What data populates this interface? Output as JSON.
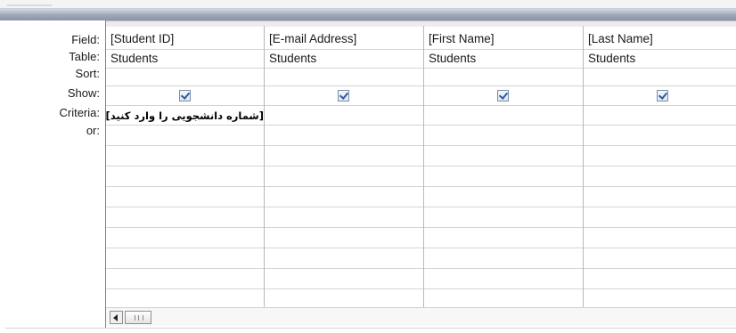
{
  "row_labels": {
    "field": "Field:",
    "table": "Table:",
    "sort": "Sort:",
    "show": "Show:",
    "criteria": "Criteria:",
    "or": "or:"
  },
  "columns": [
    {
      "field": "[Student ID]",
      "table": "Students",
      "sort": "",
      "show": true,
      "criteria": "[شماره دانشجویی را وارد کنید]"
    },
    {
      "field": "[E-mail Address]",
      "table": "Students",
      "sort": "",
      "show": true,
      "criteria": ""
    },
    {
      "field": "[First Name]",
      "table": "Students",
      "sort": "",
      "show": true,
      "criteria": ""
    },
    {
      "field": "[Last Name]",
      "table": "Students",
      "sort": "",
      "show": true,
      "criteria": ""
    }
  ],
  "icons": {
    "scroll_left": "left-arrow-icon",
    "scroll_thumb": "scroll-thumb-grip-icon",
    "show_checkbox": "checkbox-checked-icon"
  },
  "colors": {
    "splitter": "#9aa3b5",
    "checkmark": "#2f5a99",
    "gridline": "#d4d4d4"
  }
}
